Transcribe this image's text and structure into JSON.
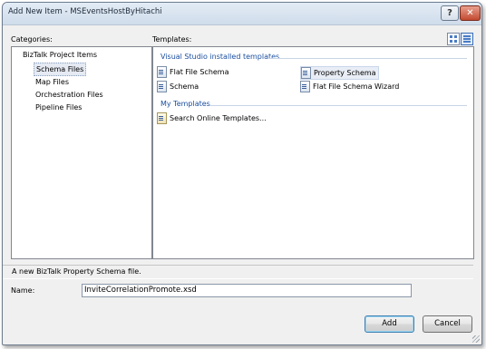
{
  "window": {
    "title": "Add New Item - MSEventsHostByHitachi"
  },
  "titlebar": {
    "help_glyph": "?",
    "close_glyph": "✕"
  },
  "categories": {
    "label": "Categories:",
    "root": "BizTalk Project Items",
    "items": [
      "Schema Files",
      "Map Files",
      "Orchestration Files",
      "Pipeline Files"
    ],
    "selected": "Schema Files"
  },
  "templates": {
    "label": "Templates:",
    "groups": [
      {
        "title": "Visual Studio installed templates",
        "items": [
          "Flat File Schema",
          "Property Schema",
          "Schema",
          "Flat File Schema Wizard"
        ]
      },
      {
        "title": "My Templates",
        "items": [
          "Search Online Templates..."
        ]
      }
    ],
    "selected": "Property Schema",
    "view_buttons": [
      "large-icons-icon",
      "small-icons-icon"
    ]
  },
  "description": "A new BizTalk Property Schema file.",
  "name": {
    "label": "Name:",
    "value": "InviteCorrelationPromote.xsd"
  },
  "buttons": {
    "add": "Add",
    "cancel": "Cancel"
  }
}
